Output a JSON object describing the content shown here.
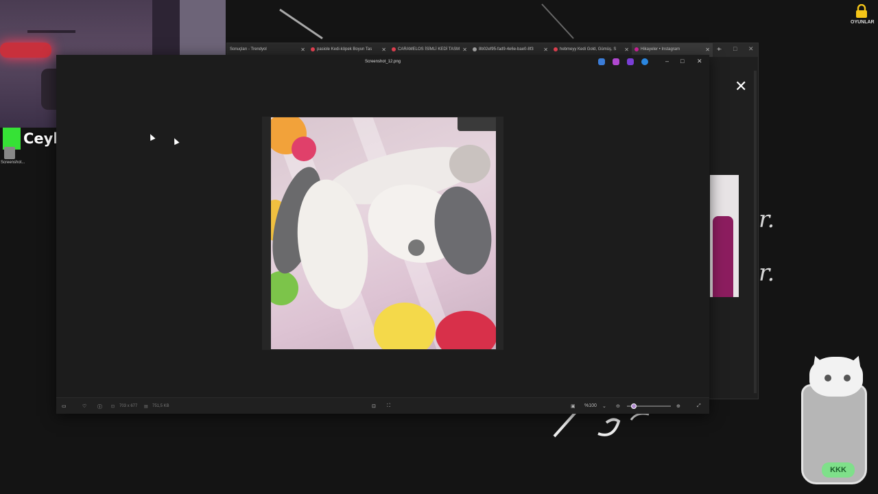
{
  "streamer": {
    "name": "Ceylan"
  },
  "desktop": {
    "icon_label": "Screenshot...",
    "lock_label": "OYUNLAR"
  },
  "browser": {
    "tabs": [
      {
        "label": "Sonuçları - Trendyol"
      },
      {
        "label": "pasiole Kedi-köpek Boyun Tas"
      },
      {
        "label": "CARAMELOS İSİMLİ KEDİ TASM"
      },
      {
        "label": "8b02ef95-fad9-4e6e-bae0-8f3"
      },
      {
        "label": "hebmeyy Kedi Gold, Gümüş, S"
      },
      {
        "label": "Hikayeler • Instagram"
      }
    ],
    "new_tab": "+",
    "close_overlay": "✕"
  },
  "viewer": {
    "title": "Screenshot_12.png",
    "dimensions": "703 x 677",
    "file_size": "751,5 KB",
    "zoom": "%100",
    "zoom_level": 0.15
  },
  "background_text": {
    "r1": "r.",
    "r2": "r."
  },
  "mug": {
    "label": "KKK"
  }
}
